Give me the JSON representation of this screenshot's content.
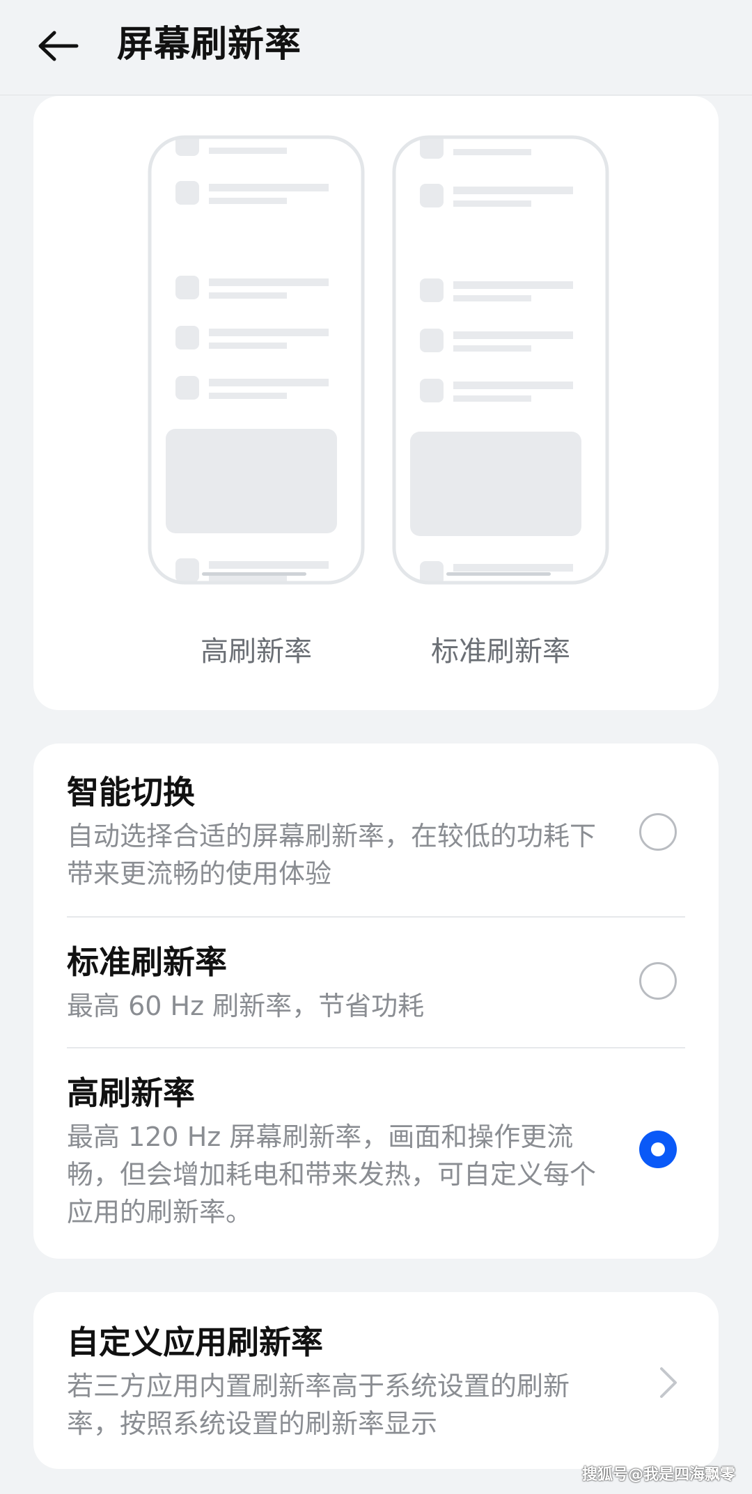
{
  "header": {
    "title": "屏幕刷新率",
    "back_icon": "arrow-left-icon"
  },
  "preview": {
    "high_label": "高刷新率",
    "standard_label": "标准刷新率"
  },
  "options": [
    {
      "title": "智能切换",
      "description": "自动选择合适的屏幕刷新率，在较低的功耗下带来更流畅的使用体验",
      "selected": false
    },
    {
      "title": "标准刷新率",
      "description": "最高 60 Hz 刷新率，节省功耗",
      "selected": false
    },
    {
      "title": "高刷新率",
      "description": "最高 120 Hz 屏幕刷新率，画面和操作更流畅，但会增加耗电和带来发热，可自定义每个应用的刷新率。",
      "selected": true
    }
  ],
  "custom": {
    "title": "自定义应用刷新率",
    "description": "若三方应用内置刷新率高于系统设置的刷新率，按照系统设置的刷新率显示",
    "chevron_icon": "chevron-right-icon"
  },
  "watermark": "搜狐号@我是四海飘零",
  "colors": {
    "accent": "#0a59f7",
    "background": "#f1f3f5",
    "card": "#ffffff"
  }
}
